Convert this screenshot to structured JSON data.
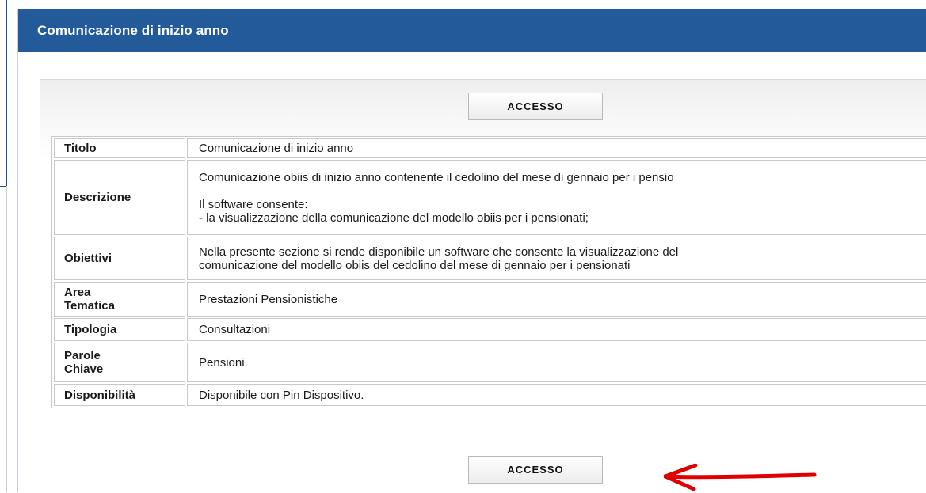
{
  "header": {
    "title": "Comunicazione di inizio anno"
  },
  "buttons": {
    "access_top": "ACCESSO",
    "access_bottom": "ACCESSO"
  },
  "table": {
    "titolo": {
      "label": "Titolo",
      "value": "Comunicazione di inizio anno"
    },
    "descrizione": {
      "label": "Descrizione",
      "line1": "Comunicazione obiis di inizio anno contenente il cedolino del mese di gennaio per i pensio",
      "line2": "Il software consente:",
      "line3": "- la visualizzazione della comunicazione del modello obiis per i pensionati;"
    },
    "obiettivi": {
      "label": "Obiettivi",
      "line1": "Nella presente sezione si rende disponibile un software che consente la visualizzazione del",
      "line2": "comunicazione del modello obiis del cedolino del mese di gennaio per i pensionati"
    },
    "area_tematica": {
      "label_line1": "Area",
      "label_line2": "Tematica",
      "value": "Prestazioni Pensionistiche"
    },
    "tipologia": {
      "label": "Tipologia",
      "value": "Consultazioni"
    },
    "parole_chiave": {
      "label_line1": "Parole",
      "label_line2": "Chiave",
      "value": "Pensioni."
    },
    "disponibilita": {
      "label": "Disponibilità",
      "value": "Disponibile con Pin Dispositivo."
    }
  },
  "colors": {
    "header_bg": "#235a9a",
    "header_text": "#ffffff",
    "annotation_arrow": "#e00000"
  },
  "icons": {
    "annotation": "red-arrow-icon"
  }
}
